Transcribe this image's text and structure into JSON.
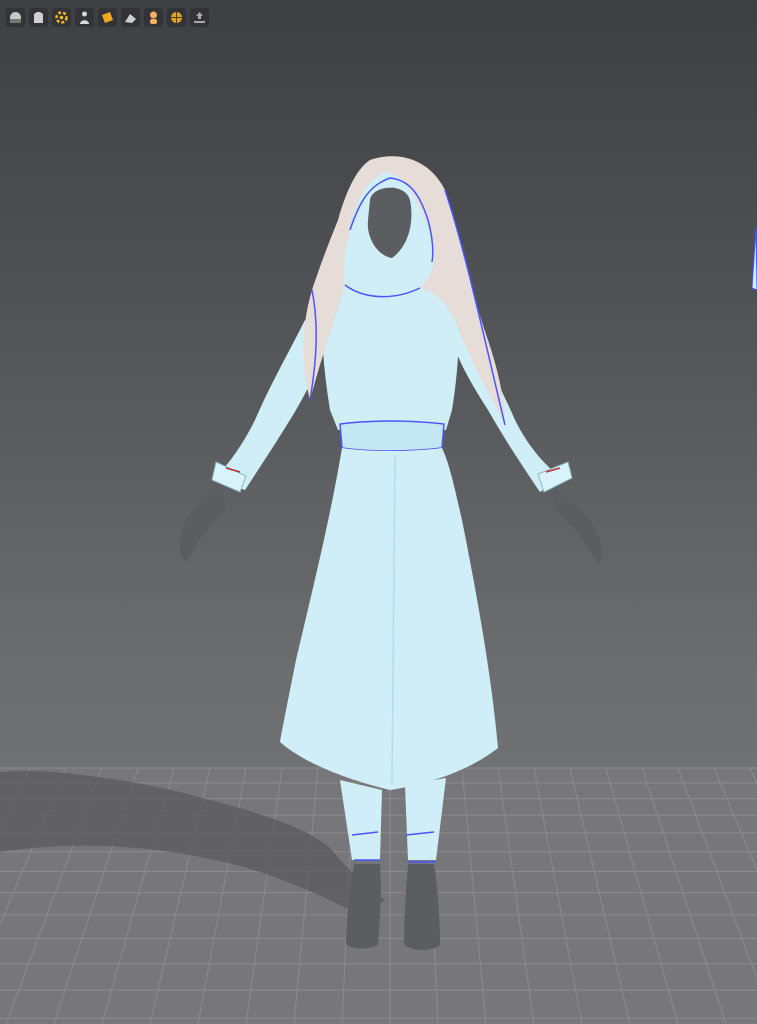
{
  "viewport": {
    "background_top": "#3e3f43",
    "background_bottom": "#7b7c7e",
    "floor_color": "#7a7a7c",
    "grid_color": "#8a8a8c",
    "garment_color": "#cfeef7",
    "seam_color": "#4a55ff",
    "hood_color": "#e6dcd8",
    "avatar_color": "#5c5d60"
  },
  "toolbar": {
    "tools": [
      {
        "icon": "avatar-shade-icon",
        "color": "#c8c8c8"
      },
      {
        "icon": "garment-shade-icon",
        "color": "#d0d0d0"
      },
      {
        "icon": "simulation-gear-icon",
        "color": "#f0b820"
      },
      {
        "icon": "avatar-figure-icon",
        "color": "#d8d8d8"
      },
      {
        "icon": "fabric-icon",
        "color": "#f0a820"
      },
      {
        "icon": "pattern-icon",
        "color": "#d0d0d0"
      },
      {
        "icon": "avatar-skin-icon",
        "color": "#f0b060"
      },
      {
        "icon": "render-globe-icon",
        "color": "#e0a020"
      },
      {
        "icon": "export-icon",
        "color": "#a8a8a8"
      }
    ]
  }
}
